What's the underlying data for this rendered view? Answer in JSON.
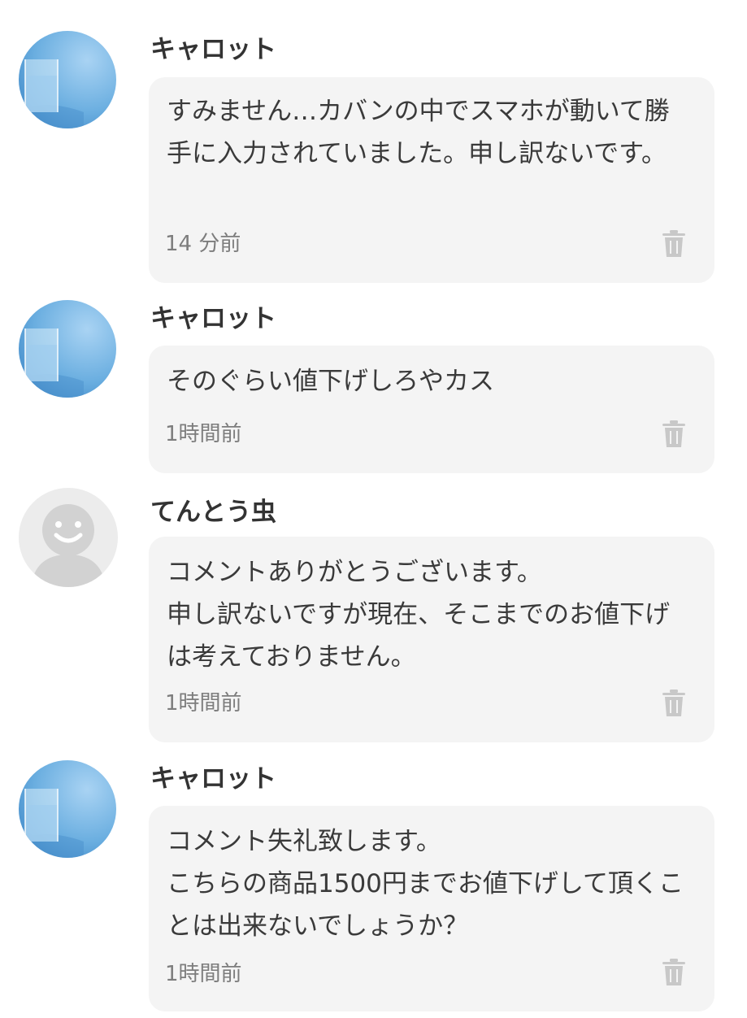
{
  "colors": {
    "bubble_bg": "#f4f4f4",
    "text": "#333333",
    "timestamp": "#7d7d7d",
    "trash_icon": "#c8c8c8",
    "avatar_water_blue": "#6aaee0",
    "avatar_default_gray": "#d2d2d2"
  },
  "comments": [
    {
      "username": "キャロット",
      "avatar": "water-glass-avatar",
      "text": "すみません…カバンの中でスマホが動いて勝手に入力されていました。申し訳ないです。",
      "time": "14 分前",
      "delete_icon": "trash-icon"
    },
    {
      "username": "キャロット",
      "avatar": "water-glass-avatar",
      "text": "そのぐらい値下げしろやカス",
      "time": "1時間前",
      "delete_icon": "trash-icon"
    },
    {
      "username": "てんとう虫",
      "avatar": "default-user-avatar",
      "text": "コメントありがとうございます。\n申し訳ないですが現在、そこまでのお値下げは考えておりません。",
      "time": "1時間前",
      "delete_icon": "trash-icon"
    },
    {
      "username": "キャロット",
      "avatar": "water-glass-avatar",
      "text": "コメント失礼致します。\nこちらの商品1500円までお値下げして頂くことは出来ないでしょうか？",
      "time": "1時間前",
      "delete_icon": "trash-icon"
    }
  ]
}
